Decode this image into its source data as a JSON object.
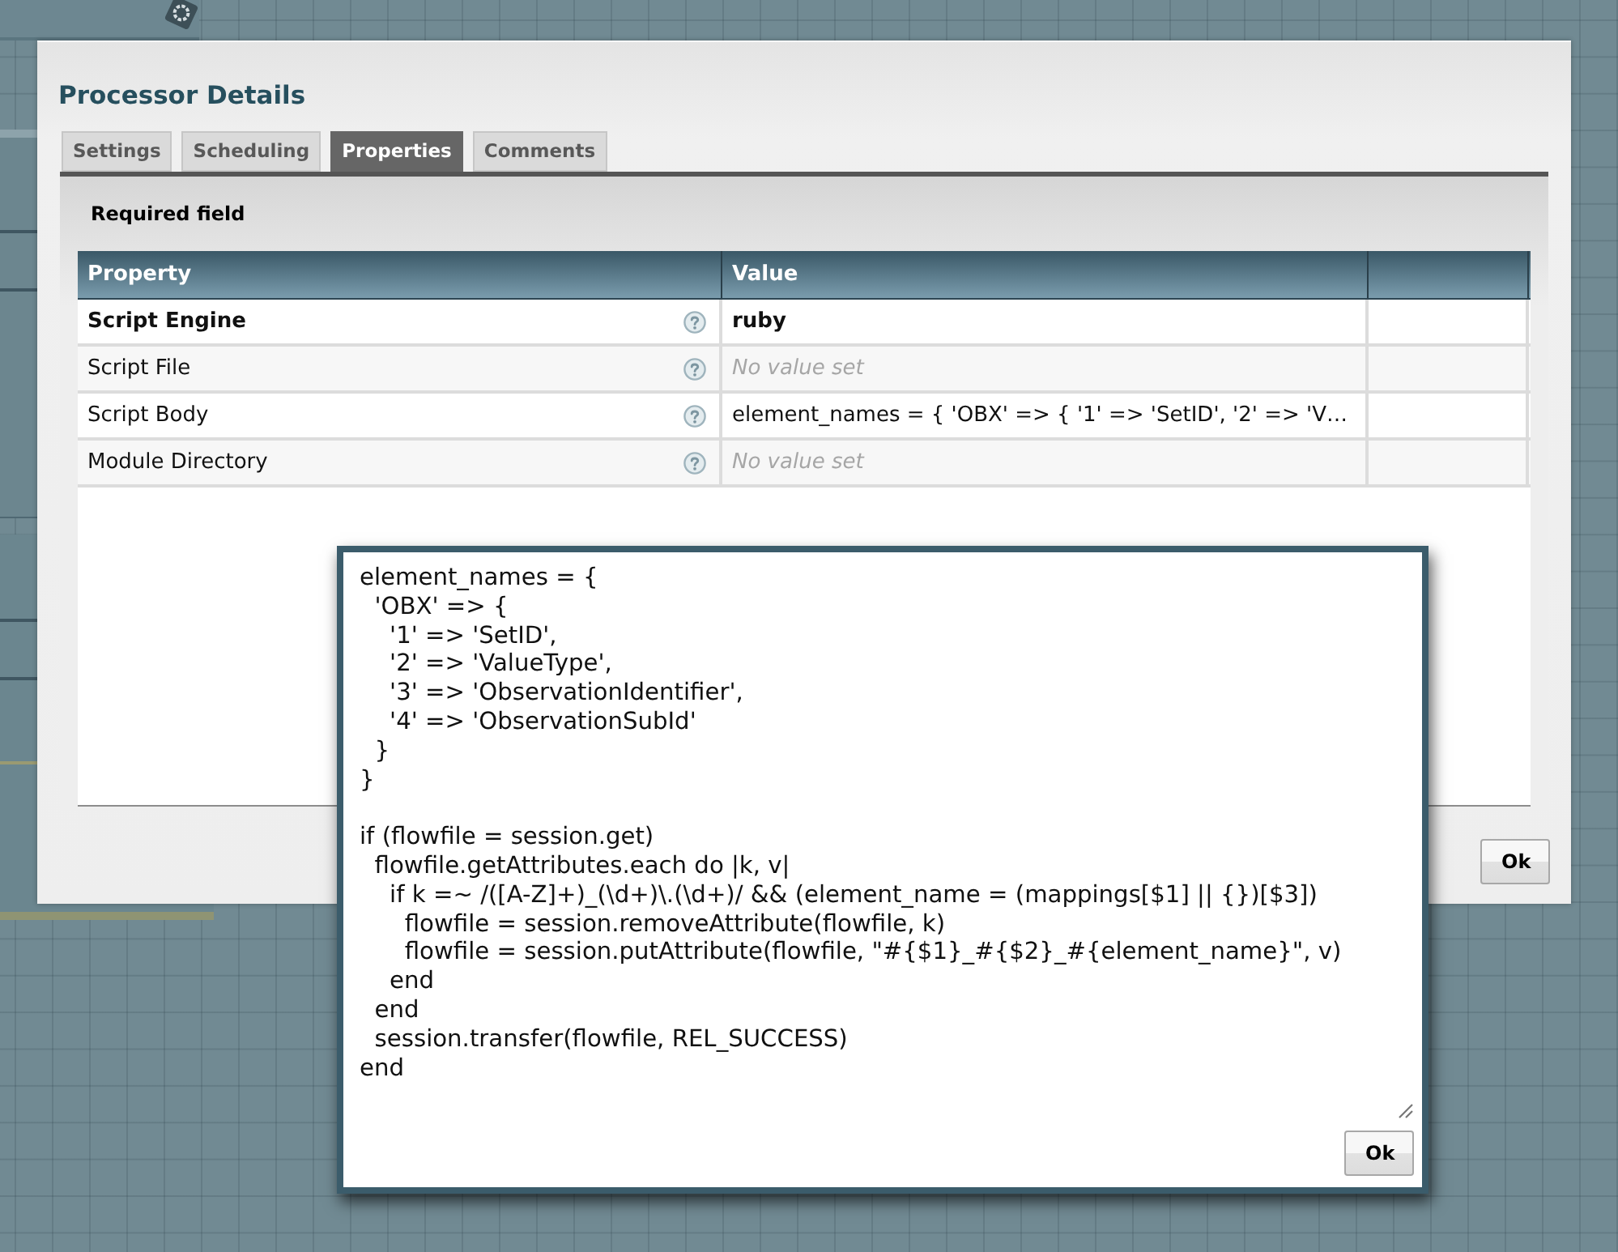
{
  "dialog": {
    "title": "Processor Details",
    "tabs": [
      {
        "label": "Settings",
        "selected": false
      },
      {
        "label": "Scheduling",
        "selected": false
      },
      {
        "label": "Properties",
        "selected": true
      },
      {
        "label": "Comments",
        "selected": false
      }
    ],
    "note": "Required field",
    "table": {
      "columns": [
        "Property",
        "Value"
      ],
      "rows": [
        {
          "name": "Script Engine",
          "required": true,
          "value": "ruby",
          "value_set": true
        },
        {
          "name": "Script File",
          "required": false,
          "value": "No value set",
          "value_set": false
        },
        {
          "name": "Script Body",
          "required": false,
          "value": "element_names = { 'OBX' => { '1' => 'SetID', '2' => 'V…",
          "value_set": true
        },
        {
          "name": "Module Directory",
          "required": false,
          "value": "No value set",
          "value_set": false
        }
      ]
    },
    "buttons": [
      "Ok"
    ]
  },
  "editor_popup": {
    "value": "element_names = {\n  'OBX' => {\n    '1' => 'SetID',\n    '2' => 'ValueType',\n    '3' => 'ObservationIdentifier',\n    '4' => 'ObservationSubId'\n  }\n}\n\nif (flowfile = session.get)\n  flowfile.getAttributes.each do |k, v|\n    if k =~ /([A-Z]+)_(\\d+)\\.(\\d+)/ && (element_name = (mappings[$1] || {})[$3])\n      flowfile = session.removeAttribute(flowfile, k)\n      flowfile = session.putAttribute(flowfile, \"#{$1}_#{$2}_#{element_name}\", v)\n    end\n  end\n  session.transfer(flowfile, REL_SUCCESS)\nend",
    "buttons": [
      "Ok"
    ]
  }
}
